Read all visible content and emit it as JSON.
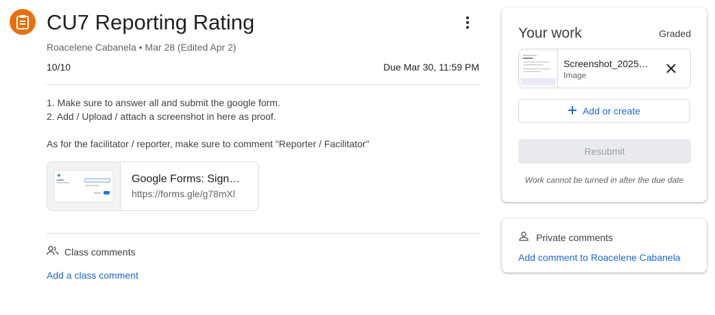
{
  "assignment": {
    "icon": "assignment-icon",
    "accent_color": "#e8710a",
    "title": "CU7 Reporting Rating",
    "author": "Roacelene Cabanela",
    "separator": "•",
    "date": "Mar 28 (Edited Apr 2)",
    "points_earned": "10",
    "points_total": "/10",
    "due": "Due Mar 30, 11:59 PM",
    "description": [
      "1. Make sure to answer all and submit the google form.",
      "2. Add / Upload / attach a screenshot in here as proof.",
      "",
      "As for the facilitator / reporter, make sure to comment \"Reporter / Facilitator\""
    ],
    "attachment": {
      "title": "Google Forms: Sign…",
      "url": "https://forms.gle/g78mXl"
    }
  },
  "class_comments": {
    "label": "Class comments",
    "add_label": "Add a class comment"
  },
  "your_work": {
    "title": "Your work",
    "status": "Graded",
    "file": {
      "name": "Screenshot_2025…",
      "type": "Image"
    },
    "add_create_label": "Add or create",
    "resubmit_label": "Resubmit",
    "note": "Work cannot be turned in after the due date"
  },
  "private_comments": {
    "label": "Private comments",
    "add_label": "Add comment to Roacelene Cabanela"
  },
  "colors": {
    "link": "#1967d2",
    "divider": "#dadce0"
  }
}
